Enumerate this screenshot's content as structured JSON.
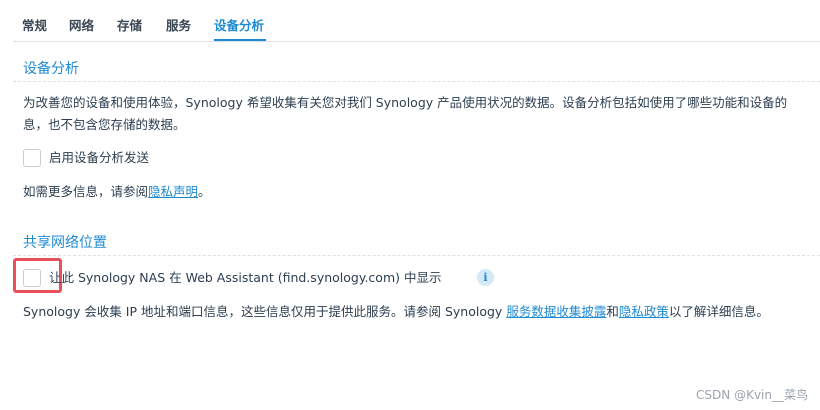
{
  "tabs": [
    {
      "label": "常规"
    },
    {
      "label": "网络"
    },
    {
      "label": "存储"
    },
    {
      "label": "服务"
    },
    {
      "label": "设备分析",
      "active": true
    }
  ],
  "device_analytics": {
    "title": "设备分析",
    "description_line1": "为改善您的设备和使用体验，Synology 希望收集有关您对我们 Synology 产品使用状况的数据。设备分析包括如使用了哪些功能和设备的",
    "description_line2": "息，也不包含您存储的数据。",
    "checkbox_label": "启用设备分析发送",
    "more_info_prefix": "如需更多信息，请参阅",
    "more_info_link": "隐私声明",
    "more_info_suffix": "。"
  },
  "shared_location": {
    "title": "共享网络位置",
    "checkbox_label": "让此 Synology NAS 在 Web Assistant (find.synology.com) 中显示",
    "info_icon_glyph": "i",
    "note_prefix": "Synology 会收集 IP 地址和端口信息，这些信息仅用于提供此服务。请参阅 Synology ",
    "note_link1": "服务数据收集披露",
    "note_mid": "和",
    "note_link2": "隐私政策",
    "note_suffix": "以了解详细信息。"
  },
  "watermark": "CSDN @Kvin__菜鸟",
  "colors": {
    "accent": "#1d8ad3",
    "highlight": "#e8505b"
  }
}
